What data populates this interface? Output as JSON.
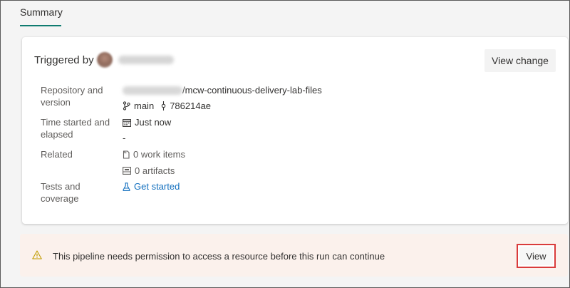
{
  "tabs": [
    {
      "label": "Summary",
      "active": true
    }
  ],
  "summary": {
    "triggered_by_label": "Triggered by",
    "view_change_label": "View change",
    "repository": {
      "label": "Repository and version",
      "name_suffix": "/mcw-continuous-delivery-lab-files",
      "branch": "main",
      "commit": "786214ae"
    },
    "time": {
      "label": "Time started and elapsed",
      "started": "Just now",
      "elapsed": "-"
    },
    "related": {
      "label": "Related",
      "work_items": "0 work items",
      "artifacts": "0 artifacts"
    },
    "tests": {
      "label": "Tests and coverage",
      "link": "Get started"
    }
  },
  "banner": {
    "message": "This pipeline needs permission to access a resource before this run can continue",
    "button_label": "View"
  },
  "icons": {
    "branch": "branch-icon",
    "commit": "commit-icon",
    "calendar": "calendar-icon",
    "work_items": "work-item-icon",
    "artifacts": "artifact-icon",
    "tests": "flask-icon",
    "warning": "warning-icon"
  },
  "colors": {
    "tab_underline": "#0f7b70",
    "link": "#106ebe",
    "banner_bg": "#fbf1ec",
    "highlight": "#d93b3b",
    "warning": "#c19c00"
  }
}
